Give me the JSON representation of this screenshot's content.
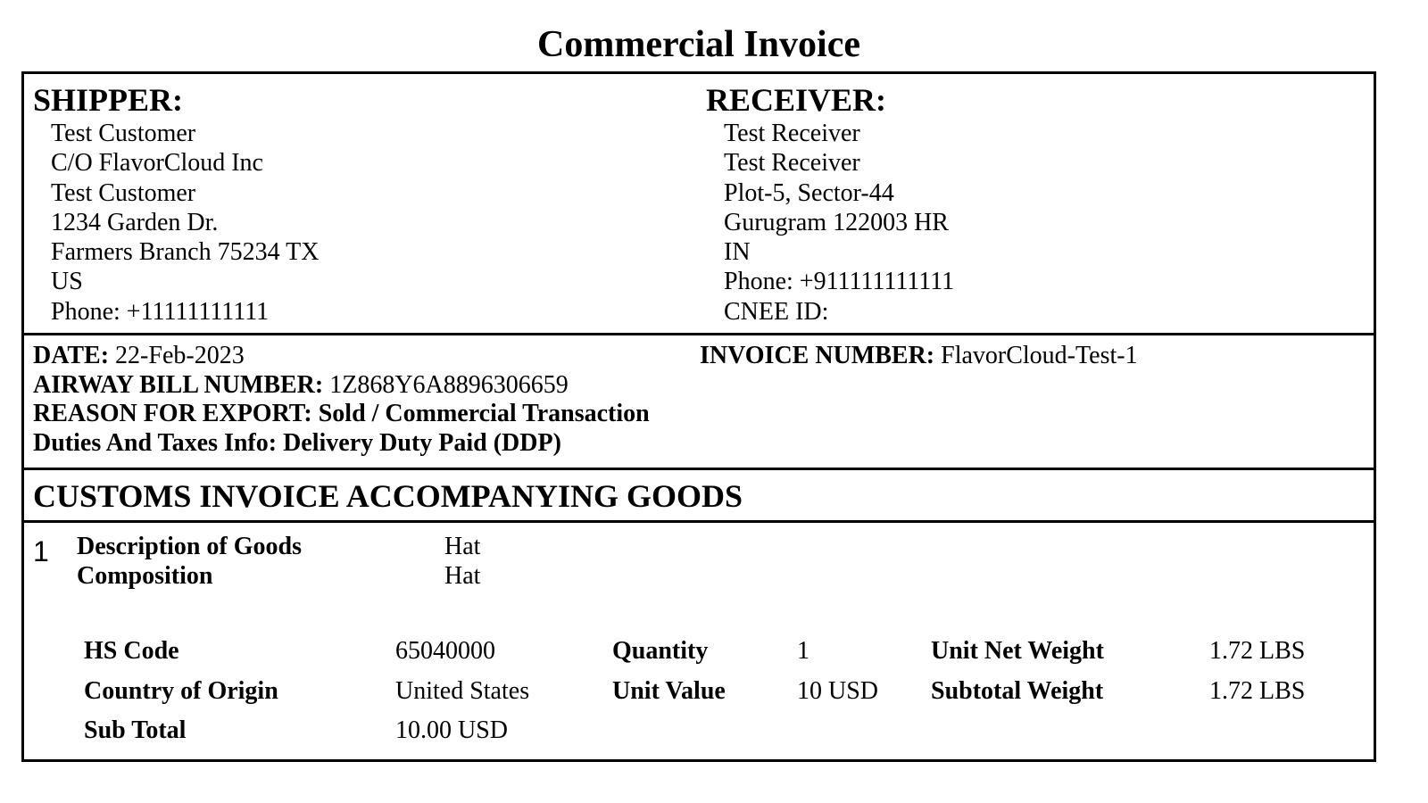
{
  "document": {
    "title": "Commercial Invoice"
  },
  "shipper": {
    "heading": "SHIPPER:",
    "lines": [
      "Test Customer",
      "C/O FlavorCloud Inc",
      "Test Customer",
      "1234 Garden Dr.",
      "Farmers Branch 75234 TX",
      "US",
      "Phone: +11111111111"
    ]
  },
  "receiver": {
    "heading": "RECEIVER:",
    "lines": [
      "Test Receiver",
      "Test Receiver",
      "Plot-5, Sector-44",
      "Gurugram 122003 HR",
      "IN",
      "Phone: +911111111111",
      "CNEE ID:"
    ]
  },
  "meta": {
    "date_label": "DATE:",
    "date_value": "22-Feb-2023",
    "invoice_number_label": "INVOICE NUMBER:",
    "invoice_number_value": "FlavorCloud-Test-1",
    "airway_bill_label": "AIRWAY BILL NUMBER:",
    "airway_bill_value": "1Z868Y6A8896306659",
    "reason_for_export": "REASON FOR EXPORT: Sold / Commercial Transaction",
    "duties_and_taxes": "Duties And Taxes Info: Delivery Duty Paid (DDP)"
  },
  "customs": {
    "heading": "CUSTOMS INVOICE ACCOMPANYING GOODS"
  },
  "items": [
    {
      "number": "1",
      "description_label": "Description of Goods",
      "description_value": "Hat",
      "composition_label": "Composition",
      "composition_value": "Hat",
      "hs_code_label": "HS Code",
      "hs_code_value": "65040000",
      "quantity_label": "Quantity",
      "quantity_value": "1",
      "unit_net_weight_label": "Unit Net Weight",
      "unit_net_weight_value": "1.72 LBS",
      "country_of_origin_label": "Country of Origin",
      "country_of_origin_value": "United States",
      "unit_value_label": "Unit Value",
      "unit_value_value": "10 USD",
      "subtotal_weight_label": "Subtotal Weight",
      "subtotal_weight_value": "1.72 LBS",
      "sub_total_label": "Sub Total",
      "sub_total_value": "10.00 USD"
    }
  ]
}
